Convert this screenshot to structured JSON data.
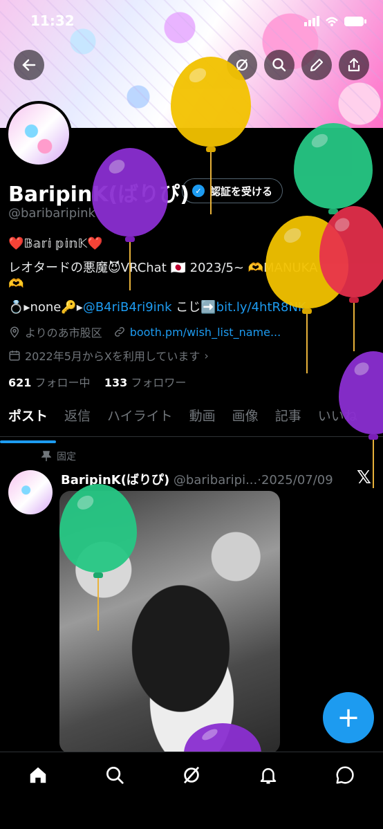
{
  "status": {
    "time": "11:32"
  },
  "header": {
    "back_icon": "back-arrow-icon",
    "grok_icon": "grok-icon",
    "search_icon": "search-icon",
    "edit_icon": "pencil-icon",
    "share_icon": "share-icon"
  },
  "profile": {
    "name": "BaripinK(ばりぴ)",
    "handle": "@baribaripink",
    "verify_label": "認証を受ける",
    "bio_line1": "❤️𝔹𝕒𝕣𝕚 𝕡𝕚𝕟𝕂❤️",
    "bio_line2": "レオタードの悪魔😈VRChat 🇯🇵 2023/5~ 🫶MANUKA",
    "bio_line3": "🫶",
    "bio_line4_prefix": "💍▸none🔑▸",
    "bio_line4_mention": "@B4riB4ri9ink",
    "bio_line4_mid": " こじ➡️",
    "bio_line4_link": "bit.ly/4htR8NK",
    "location": "よりのあ市股区",
    "website": "booth.pm/wish_list_name...",
    "joined": "2022年5月からXを利用しています",
    "following_count": "621",
    "following_label": "フォロー中",
    "followers_count": "133",
    "followers_label": "フォロワー"
  },
  "tabs": [
    {
      "label": "ポスト"
    },
    {
      "label": "返信"
    },
    {
      "label": "ハイライト"
    },
    {
      "label": "動画"
    },
    {
      "label": "画像"
    },
    {
      "label": "記事"
    },
    {
      "label": "いいね"
    }
  ],
  "post": {
    "pinned_label": "固定",
    "author": "BaripinK(ばりぴ)",
    "handle_date": "@baribaripi...·2025/07/09",
    "x_logo": "𝕏"
  },
  "fab": {
    "label": "+"
  },
  "bottom_nav": [
    "home-icon",
    "search-icon",
    "grok-icon",
    "bell-icon",
    "messages-icon"
  ],
  "colors": {
    "accent": "#1d9bf0",
    "background": "#000000",
    "muted": "#71767b"
  }
}
